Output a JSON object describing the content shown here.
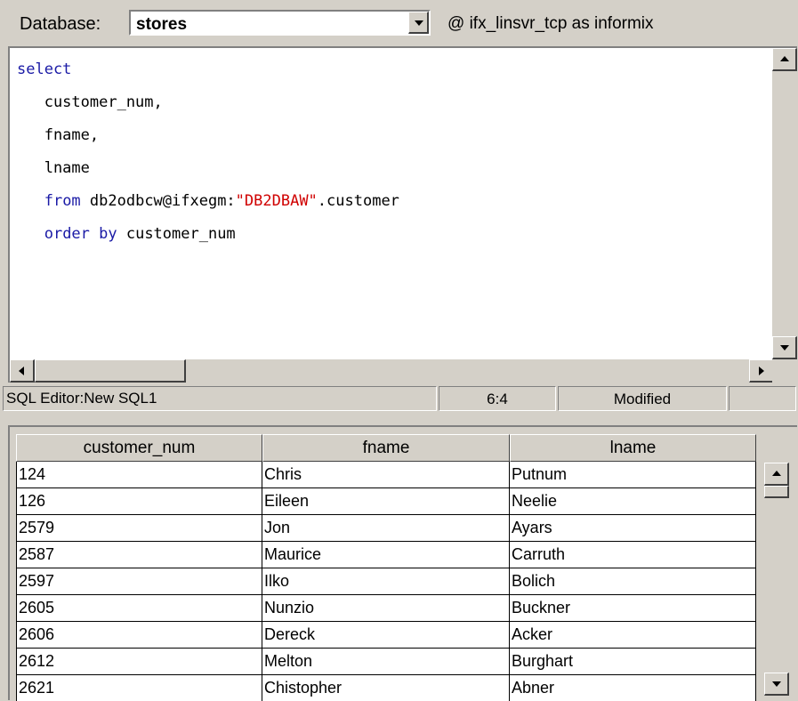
{
  "database_bar": {
    "label": "Database:",
    "selected": "stores",
    "connection": "@ ifx_linsvr_tcp as informix"
  },
  "editor": {
    "lines": [
      [
        {
          "t": "select",
          "c": "kw"
        }
      ],
      [
        {
          "t": "   customer_num,",
          "c": ""
        }
      ],
      [
        {
          "t": "   fname,",
          "c": ""
        }
      ],
      [
        {
          "t": "   lname",
          "c": ""
        }
      ],
      [
        {
          "t": "   ",
          "c": ""
        },
        {
          "t": "from",
          "c": "kw"
        },
        {
          "t": " db2odbcw@ifxegm:",
          "c": ""
        },
        {
          "t": "\"DB2DBAW\"",
          "c": "str"
        },
        {
          "t": ".customer",
          "c": ""
        }
      ],
      [
        {
          "t": "   ",
          "c": ""
        },
        {
          "t": "order by",
          "c": "kw"
        },
        {
          "t": " customer_num",
          "c": ""
        }
      ]
    ]
  },
  "status_bar": {
    "title": "SQL Editor:New SQL1",
    "position": "6:4",
    "state": "Modified"
  },
  "results": {
    "columns": [
      "customer_num",
      "fname",
      "lname"
    ],
    "rows": [
      [
        "124",
        "Chris",
        "Putnum"
      ],
      [
        "126",
        "Eileen",
        "Neelie"
      ],
      [
        "2579",
        "Jon",
        "Ayars"
      ],
      [
        "2587",
        "Maurice",
        "Carruth"
      ],
      [
        "2597",
        "Ilko",
        "Bolich"
      ],
      [
        "2605",
        "Nunzio",
        "Buckner"
      ],
      [
        "2606",
        "Dereck",
        "Acker"
      ],
      [
        "2612",
        "Melton",
        "Burghart"
      ],
      [
        "2621",
        "Chistopher",
        "Abner"
      ]
    ]
  },
  "colors": {
    "window_bg": "#d4d0c8",
    "keyword": "#1a1aa6",
    "string": "#d00000"
  }
}
